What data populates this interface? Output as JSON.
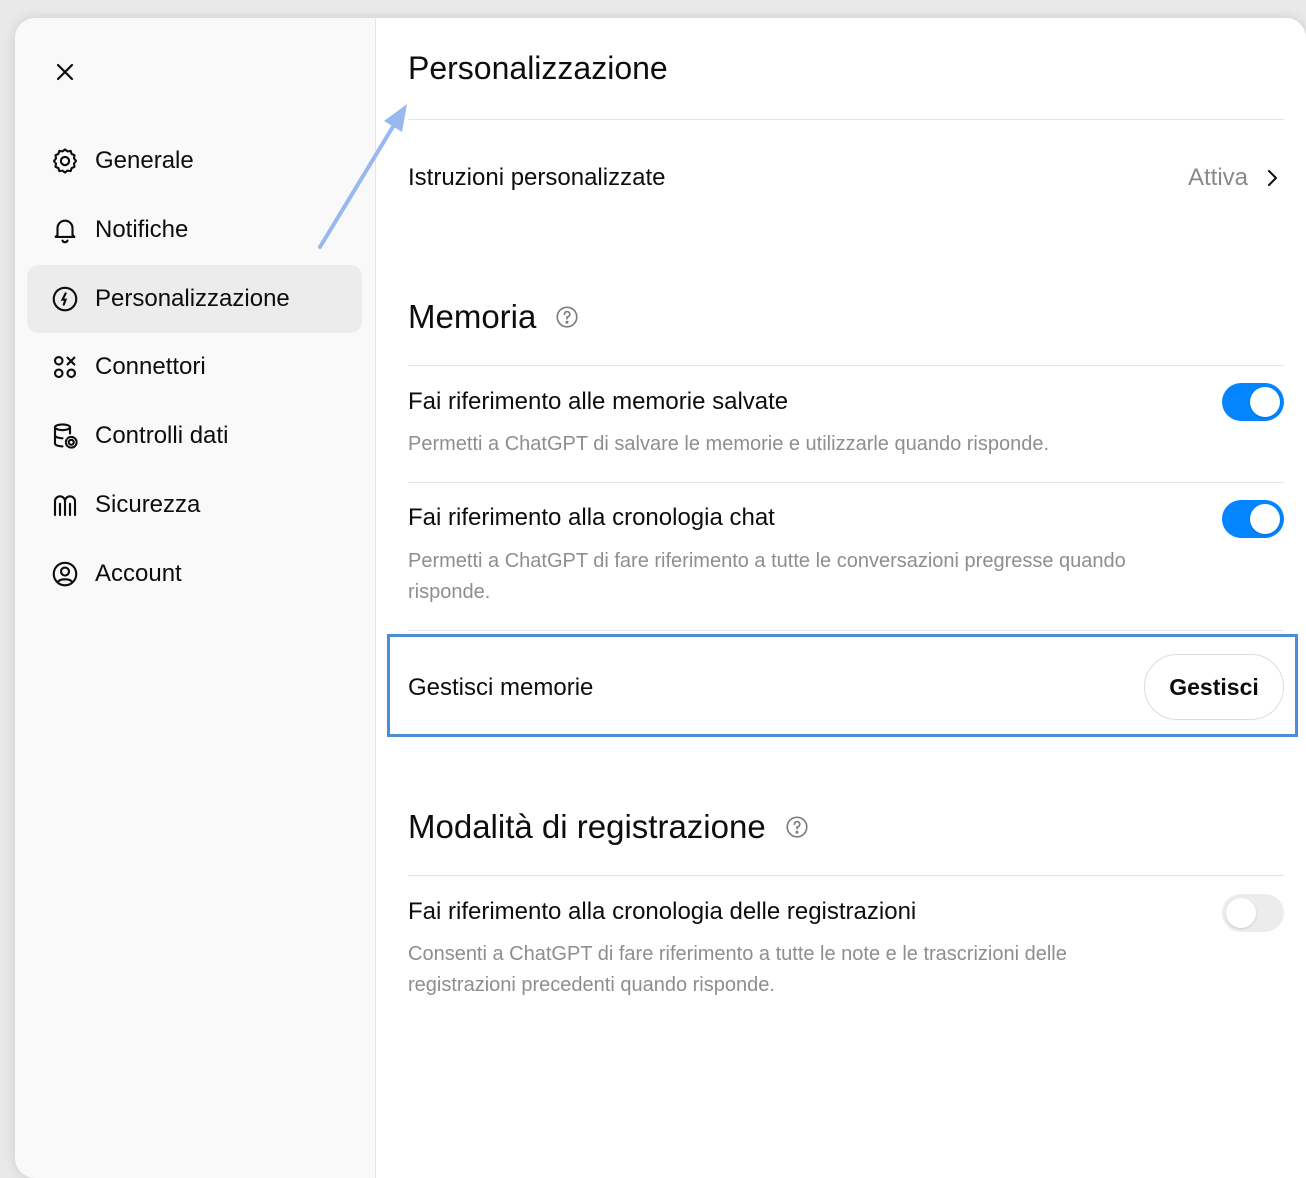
{
  "sidebar": {
    "close_icon": "close-icon",
    "items": [
      {
        "label": "Generale",
        "icon": "gear-icon",
        "active": false
      },
      {
        "label": "Notifiche",
        "icon": "bell-icon",
        "active": false
      },
      {
        "label": "Personalizzazione",
        "icon": "personalization-icon",
        "active": true
      },
      {
        "label": "Connettori",
        "icon": "connectors-icon",
        "active": false
      },
      {
        "label": "Controlli dati",
        "icon": "database-gear-icon",
        "active": false
      },
      {
        "label": "Sicurezza",
        "icon": "security-icon",
        "active": false
      },
      {
        "label": "Account",
        "icon": "account-icon",
        "active": false
      }
    ]
  },
  "main": {
    "title": "Personalizzazione",
    "custom_instructions": {
      "label": "Istruzioni personalizzate",
      "status": "Attiva"
    },
    "memory": {
      "title": "Memoria",
      "saved_memories": {
        "label": "Fai riferimento alle memorie salvate",
        "description": "Permetti a ChatGPT di salvare le memorie e utilizzarle quando risponde.",
        "enabled": true
      },
      "chat_history": {
        "label": "Fai riferimento alla cronologia chat",
        "description": "Permetti a ChatGPT di fare riferimento a tutte le conversazioni pregresse quando risponde.",
        "enabled": true
      },
      "manage": {
        "label": "Gestisci memorie",
        "button": "Gestisci"
      }
    },
    "recording": {
      "title": "Modalità di registrazione",
      "history": {
        "label": "Fai riferimento alla cronologia delle registrazioni",
        "description": "Consenti a ChatGPT di fare riferimento a tutte le note e le trascrizioni delle registrazioni precedenti quando risponde.",
        "enabled": false
      }
    }
  },
  "colors": {
    "toggle_on": "#0285ff",
    "highlight_border": "#4a8fd6",
    "annotation_arrow": "#9ab8f0"
  }
}
